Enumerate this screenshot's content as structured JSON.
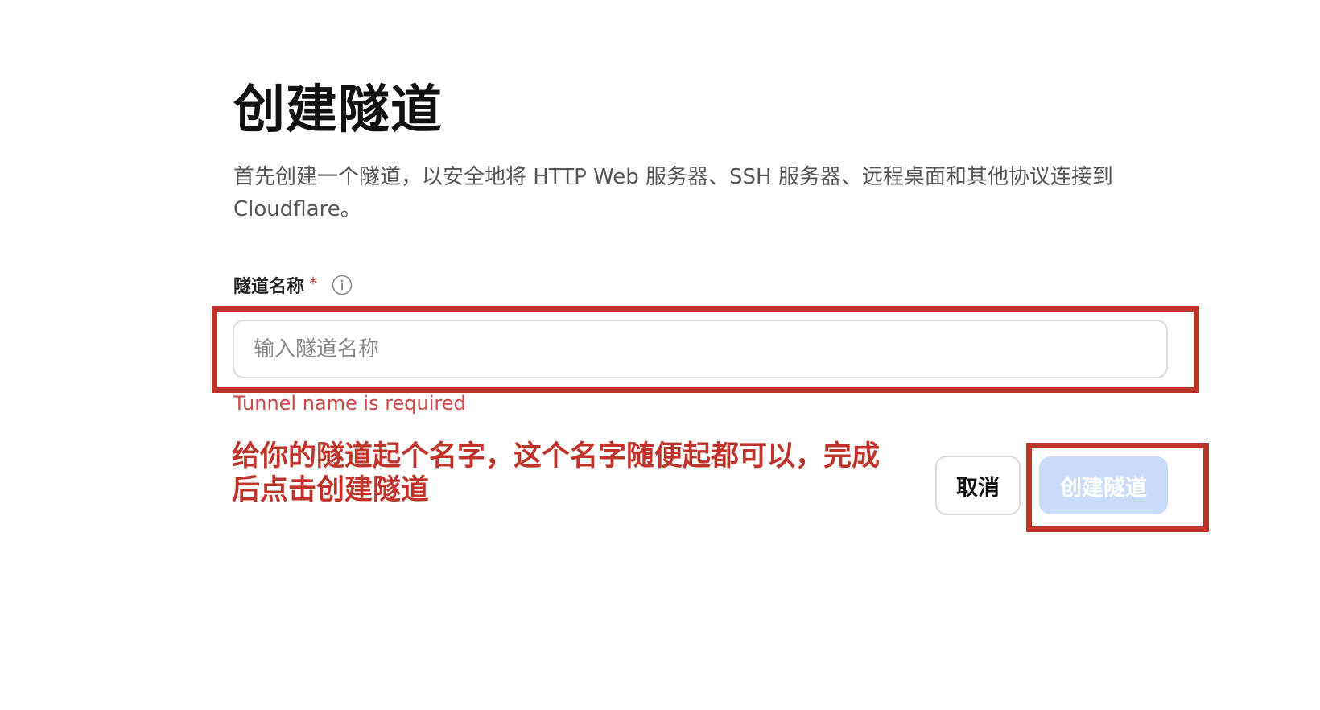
{
  "page": {
    "title": "创建隧道",
    "description": "首先创建一个隧道，以安全地将 HTTP Web 服务器、SSH 服务器、远程桌面和其他协议连接到 Cloudflare。"
  },
  "form": {
    "tunnel_name": {
      "label": "隧道名称",
      "required_marker": "*",
      "placeholder": "输入隧道名称",
      "value": "",
      "error": "Tunnel name is required",
      "info_icon": "info-circle-icon"
    },
    "actions": {
      "cancel_label": "取消",
      "create_label": "创建隧道",
      "create_disabled": true
    }
  },
  "annotation": {
    "text": "给你的隧道起个名字，这个名字随便起都可以，完成后点击创建隧道",
    "color": "#c0332a"
  },
  "colors": {
    "error": "#d04848",
    "primary_disabled": "#cbdcfb",
    "annotation": "#c0332a"
  }
}
